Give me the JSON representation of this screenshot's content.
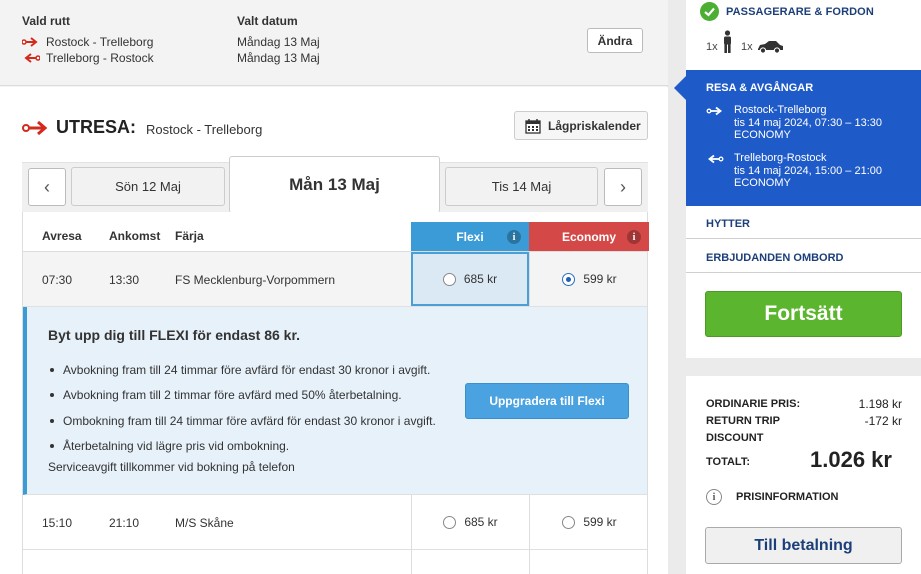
{
  "summary": {
    "route_title": "Vald rutt",
    "date_title": "Valt datum",
    "routes": [
      "Rostock - Trelleborg",
      "Trelleborg - Rostock"
    ],
    "dates": [
      "Måndag 13 Maj",
      "Måndag 13 Maj"
    ],
    "change_label": "Ändra"
  },
  "outbound": {
    "title": "UTRESA:",
    "route": "Rostock - Trelleborg",
    "calendar_label": "Lågpriskalender"
  },
  "dates": {
    "prev": "Sön 12 Maj",
    "active": "Mån 13 Maj",
    "next": "Tis 14 Maj"
  },
  "table": {
    "headers": {
      "depart": "Avresa",
      "arrive": "Ankomst",
      "ferry": "Färja",
      "flexi": "Flexi",
      "economy": "Economy"
    },
    "rows": [
      {
        "depart": "07:30",
        "arrive": "13:30",
        "ferry": "FS Mecklenburg-Vorpommern",
        "flexi": "685 kr",
        "economy": "599 kr"
      },
      {
        "depart": "15:10",
        "arrive": "21:10",
        "ferry": "M/S Skåne",
        "flexi": "685 kr",
        "economy": "599 kr"
      }
    ]
  },
  "upsell": {
    "title": "Byt upp dig till FLEXI för endast 86 kr.",
    "bullets": [
      "Avbokning fram till 24 timmar före avfärd för endast 30 kronor i avgift.",
      "Avbokning fram till 2 timmar före avfärd med 50% återbetalning.",
      "Ombokning fram till 24 timmar före avfärd för endast 30 kronor i avgift.",
      "Återbetalning vid lägre pris vid ombokning."
    ],
    "note": "Serviceavgift tillkommer vid bokning på telefon",
    "button": "Uppgradera till Flexi"
  },
  "sidebar": {
    "passengers_title": "PASSAGERARE & FORDON",
    "passengers_count": "1x",
    "vehicle_count": "1x",
    "trip_title": "RESA & AVGÅNGAR",
    "trips": [
      {
        "route": "Rostock-Trelleborg",
        "time": "tis 14 maj 2024, 07:30 – 13:30",
        "class": "ECONOMY"
      },
      {
        "route": "Trelleborg-Rostock",
        "time": "tis 14 maj 2024, 15:00 – 21:00",
        "class": "ECONOMY"
      }
    ],
    "cabins": "HYTTER",
    "onboard": "ERBJUDANDEN OMBORD",
    "continue": "Fortsätt"
  },
  "price": {
    "ordinary_label": "ORDINARIE PRIS:",
    "ordinary_value": "1.198 kr",
    "discount_label_1": "RETURN TRIP",
    "discount_label_2": "DISCOUNT",
    "discount_value": "-172 kr",
    "total_label": "TOTALT:",
    "total_value": "1.026 kr",
    "info_label": "PRISINFORMATION",
    "pay_button": "Till betalning"
  },
  "colors": {
    "flexi": "#3b9bd6",
    "economy": "#d44848",
    "brand_red": "#d42a1e",
    "sidebar_blue": "#1f5bc8",
    "continue_green": "#5cb52f"
  }
}
